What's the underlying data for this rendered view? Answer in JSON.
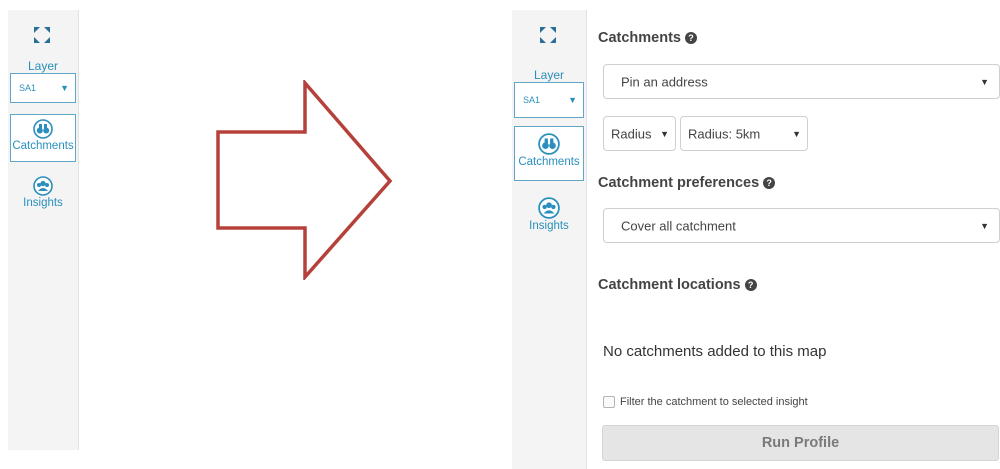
{
  "rail": {
    "layer_label": "Layer",
    "layer_value": "SA1",
    "catchments_label": "Catchments",
    "insights_label": "Insights"
  },
  "panel": {
    "catchments_title": "Catchments",
    "address_select": "Pin an address",
    "radius_type_select": "Radius",
    "radius_value_select": "Radius: 5km",
    "preferences_title": "Catchment preferences",
    "preferences_select": "Cover all catchment",
    "locations_title": "Catchment locations",
    "empty_message": "No catchments added to this map",
    "filter_label": "Filter the catchment to selected insight",
    "run_button": "Run Profile"
  },
  "colors": {
    "accent": "#2a8fbd",
    "arrow": "#b5413a",
    "disabled_button": "#e5e5e5"
  }
}
